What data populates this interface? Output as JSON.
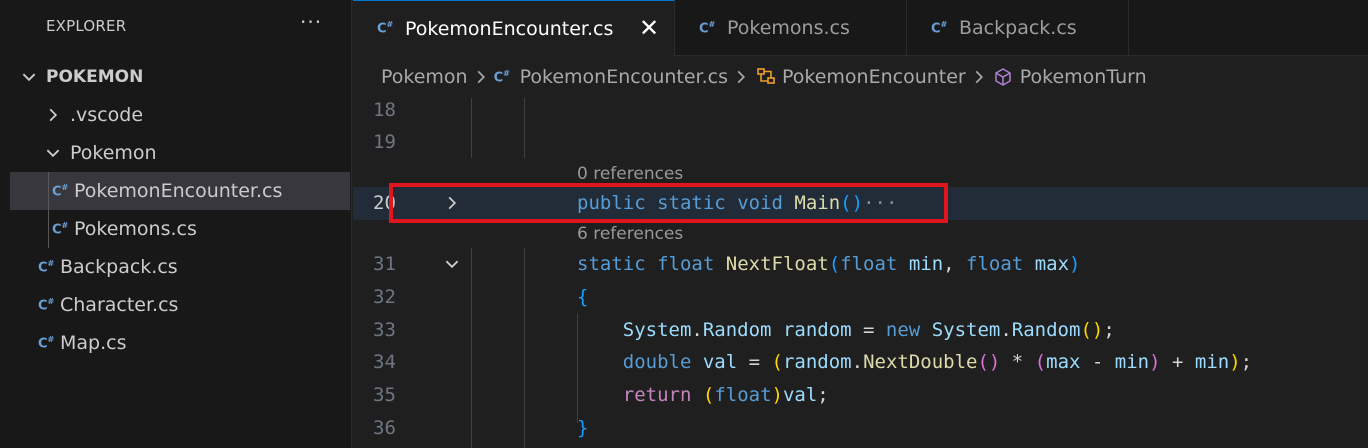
{
  "explorer": {
    "title": "EXPLORER",
    "more": "···",
    "folder": "POKEMON",
    "items": [
      {
        "label": ".vscode"
      },
      {
        "label": "Pokemon"
      },
      {
        "label": "PokemonEncounter.cs"
      },
      {
        "label": "Pokemons.cs"
      },
      {
        "label": "Backpack.cs"
      },
      {
        "label": "Character.cs"
      },
      {
        "label": "Map.cs"
      }
    ]
  },
  "file_icon_glyph": "C",
  "file_icon_sup": "#",
  "tabs": [
    {
      "label": "PokemonEncounter.cs",
      "close": "✕"
    },
    {
      "label": "Pokemons.cs"
    },
    {
      "label": "Backpack.cs"
    }
  ],
  "breadcrumb": [
    "Pokemon",
    "PokemonEncounter.cs",
    "PokemonEncounter",
    "PokemonTurn"
  ],
  "editor": {
    "line_numbers": [
      "18",
      "19",
      "20",
      "31",
      "32",
      "33",
      "34",
      "35",
      "36"
    ],
    "codelens": [
      "0 references",
      "6 references"
    ],
    "lines": {
      "l20": {
        "t1": "public",
        "t2": "static",
        "t3": "void",
        "t4": "Main",
        "t5": "()",
        "t6": "···"
      },
      "l31": {
        "t1": "static",
        "t2": "float",
        "t3": "NextFloat",
        "t4": "(",
        "t5": "float",
        "t6": "min",
        "t7": ", ",
        "t8": "float",
        "t9": "max",
        "t10": ")"
      },
      "l32": {
        "t1": "{"
      },
      "l33": {
        "t1": "System",
        "t2": ".",
        "t3": "Random",
        "t4": "random",
        "t5": " = ",
        "t6": "new",
        "t7": "System",
        "t8": ".",
        "t9": "Random",
        "t10": "()",
        "t11": ";"
      },
      "l34": {
        "t1": "double",
        "t2": "val",
        "t3": " = ",
        "t4": "(",
        "t5": "random",
        "t6": ".",
        "t7": "NextDouble",
        "t8": "()",
        "t9": " * ",
        "t10": "(",
        "t11": "max",
        "t12": " - ",
        "t13": "min",
        "t14": ")",
        "t15": " + ",
        "t16": "min",
        "t17": ")",
        "t18": ";"
      },
      "l35": {
        "t1": "return",
        "t2": "(",
        "t3": "float",
        "t4": ")",
        "t5": "val",
        "t6": ";"
      },
      "l36": {
        "t1": "}"
      }
    }
  },
  "colors": {
    "accent": "#0078d4",
    "highlight_box": "#e0161e",
    "keyword": "#569cd6",
    "function": "#dcdcaa",
    "control": "#c586c0"
  }
}
